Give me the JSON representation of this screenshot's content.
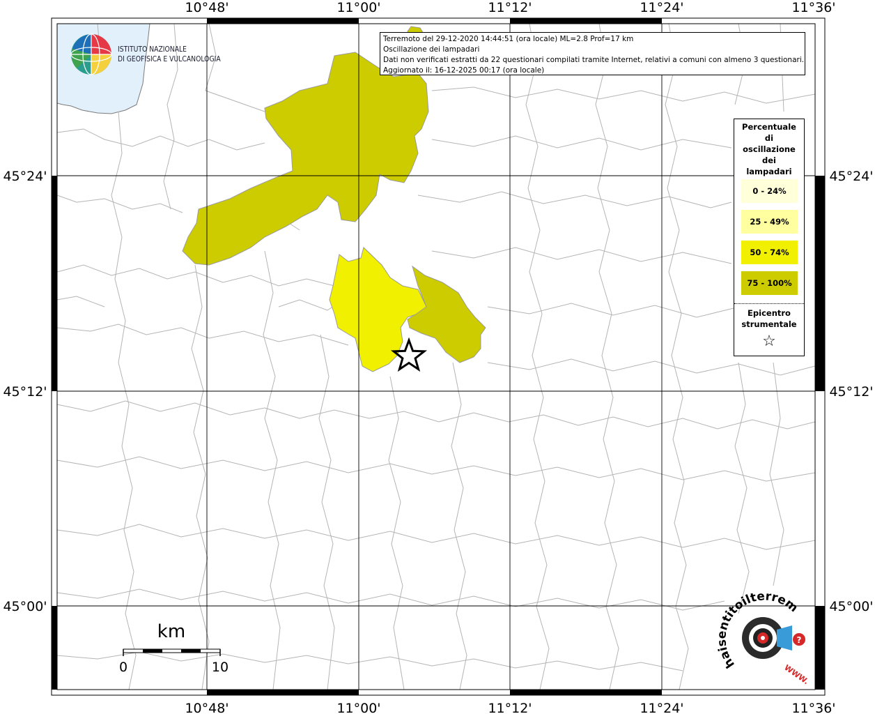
{
  "map": {
    "longitude_labels": [
      "10°48'",
      "11°00'",
      "11°12'",
      "11°24'",
      "11°36'"
    ],
    "latitude_labels": [
      "45°24'",
      "45°12'",
      "45°00'"
    ],
    "epicenter_marker": "star-icon",
    "shaded_municipalities": [
      {
        "name": "north-large-area",
        "class": "75 - 100%"
      },
      {
        "name": "east-area",
        "class": "75 - 100%"
      },
      {
        "name": "central-area",
        "class": "50 - 74%"
      },
      {
        "name": "north-small-area",
        "class": "75 - 100%"
      }
    ]
  },
  "info": {
    "line1": "Terremoto del 29-12-2020 14:44:51 (ora locale) ML=2.8 Prof=17 km",
    "line2": "Oscillazione dei lampadari",
    "line3": "Dati non verificati estratti da 22 questionari compilati tramite Internet, relativi a comuni con almeno 3 questionari.",
    "line4": "Aggiornato il: 16-12-2025 00:17 (ora locale)"
  },
  "legend": {
    "title": "Percentuale di oscillazione dei lampadari",
    "items": [
      {
        "label": "0 - 24%",
        "color": "#ffffd9"
      },
      {
        "label": "25 - 49%",
        "color": "#ffffa0"
      },
      {
        "label": "50 - 74%",
        "color": "#f0f000"
      },
      {
        "label": "75 - 100%",
        "color": "#cccc00"
      }
    ],
    "epicenter_label": "Epicentro strumentale",
    "epicenter_symbol": "☆"
  },
  "scale_bar": {
    "unit": "km",
    "start": "0",
    "end": "10"
  },
  "logos": {
    "ingv_line1": "ISTITUTO NAZIONALE",
    "ingv_line2": "DI GEOFISICA E VULCANOLOGIA",
    "hst_text": "haisentitoilterremoto.it",
    "hst_www": "WWW."
  },
  "colors": {
    "class_75_100": "#cccc00",
    "class_50_74": "#f0f000",
    "water": "#e2f0fb",
    "grid": "#000000",
    "boundaries": "#b4b4b4"
  }
}
